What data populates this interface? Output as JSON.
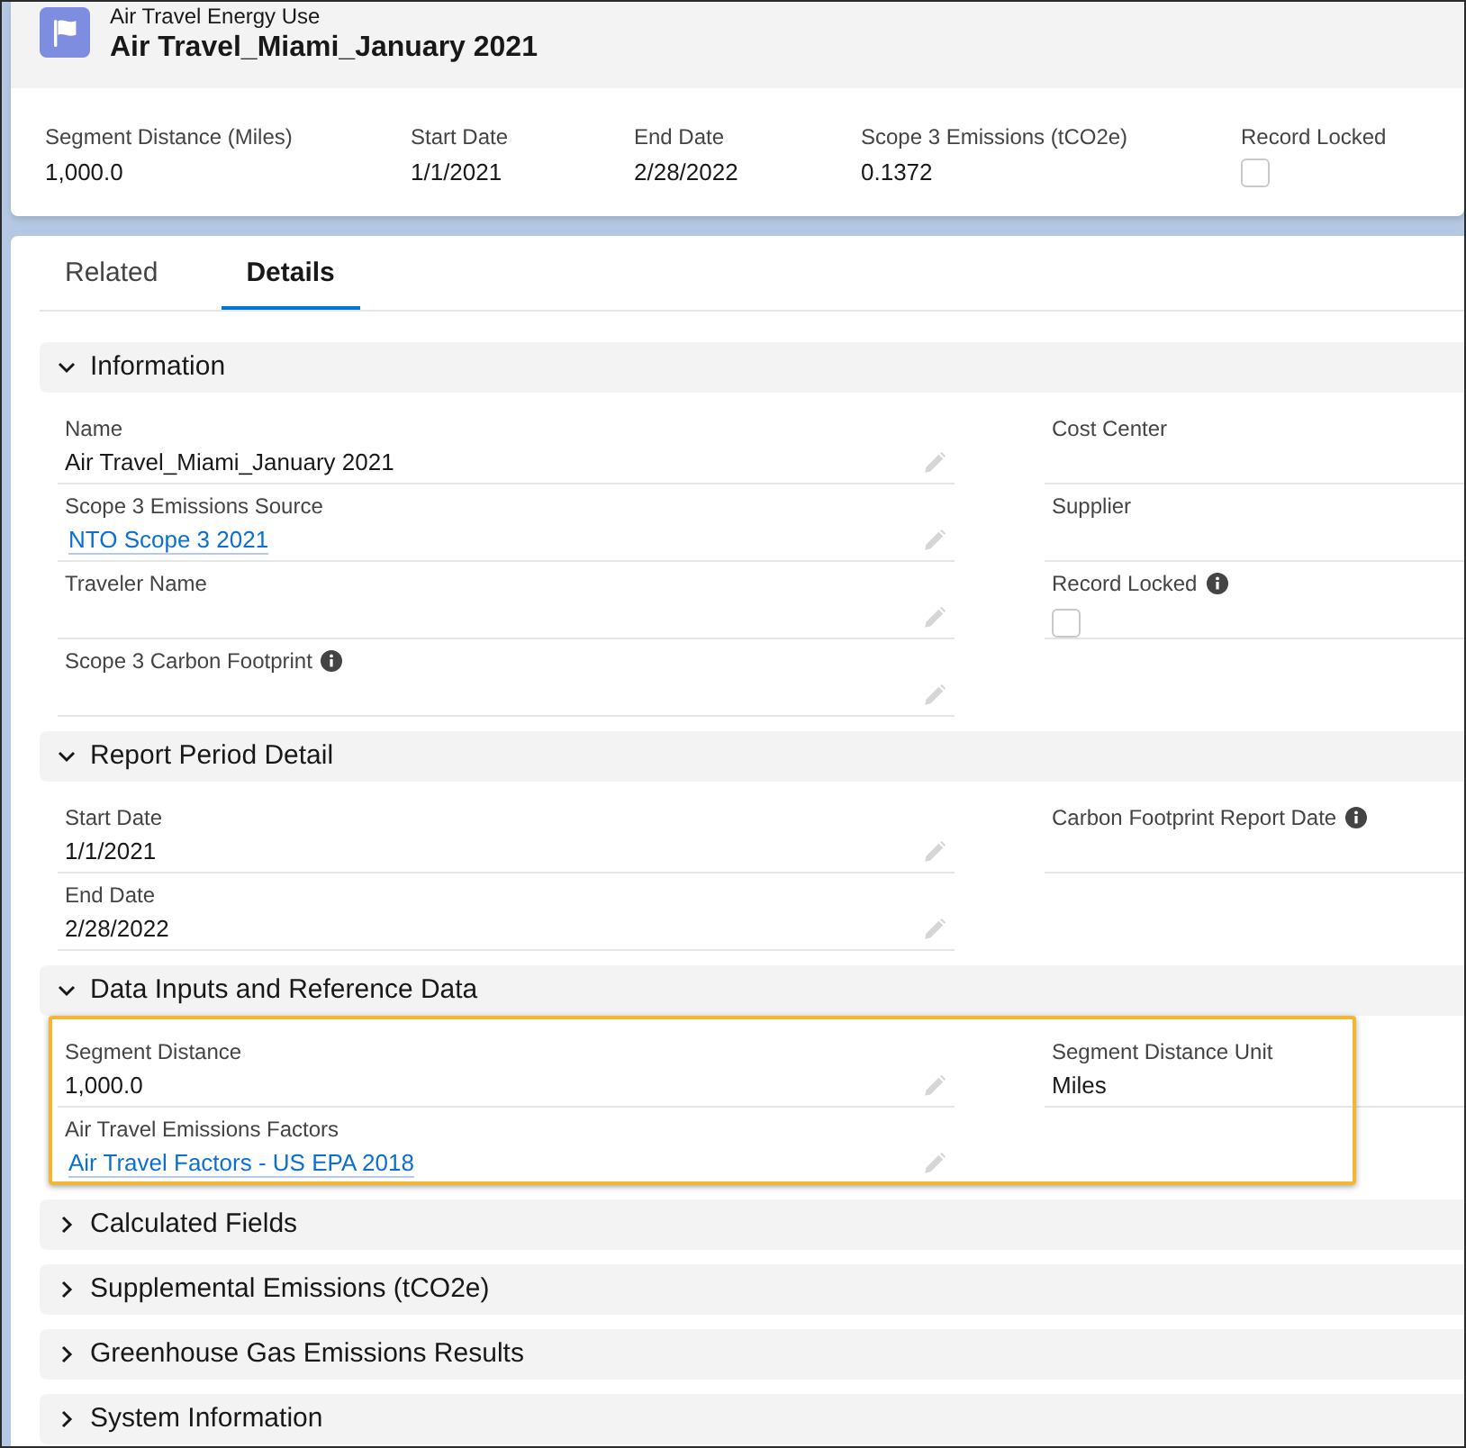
{
  "record": {
    "object_type": "Air Travel Energy Use",
    "title": "Air Travel_Miami_January 2021"
  },
  "highlights": [
    {
      "kind": "text",
      "label": "Segment Distance (Miles)",
      "value": "1,000.0"
    },
    {
      "kind": "text",
      "label": "Start Date",
      "value": "1/1/2021"
    },
    {
      "kind": "text",
      "label": "End Date",
      "value": "2/28/2022"
    },
    {
      "kind": "text",
      "label": "Scope 3 Emissions (tCO2e)",
      "value": "0.1372"
    },
    {
      "kind": "checkbox",
      "label": "Record Locked",
      "checked": false
    }
  ],
  "tabs": [
    {
      "label": "Related",
      "selected": false
    },
    {
      "label": "Details",
      "selected": true
    }
  ],
  "sections": [
    {
      "title": "Information",
      "expanded": true,
      "highlighted": false,
      "rows": [
        [
          {
            "kind": "text",
            "label": "Name",
            "value": "Air Travel_Miami_January 2021",
            "info": false,
            "editable": true
          },
          {
            "kind": "text",
            "label": "Cost Center",
            "info": false,
            "editable": false
          }
        ],
        [
          {
            "kind": "link",
            "label": "Scope 3 Emissions Source",
            "value": "NTO Scope 3 2021",
            "info": false,
            "editable": true
          },
          {
            "kind": "text",
            "label": "Supplier",
            "info": false,
            "editable": false
          }
        ],
        [
          {
            "kind": "text",
            "label": "Traveler Name",
            "info": false,
            "editable": true
          },
          {
            "kind": "checkbox",
            "label": "Record Locked",
            "info": true,
            "checked": false,
            "editable": false
          }
        ],
        [
          {
            "kind": "text",
            "label": "Scope 3 Carbon Footprint",
            "info": true,
            "editable": true
          }
        ]
      ]
    },
    {
      "title": "Report Period Detail",
      "expanded": true,
      "highlighted": false,
      "rows": [
        [
          {
            "kind": "text",
            "label": "Start Date",
            "value": "1/1/2021",
            "info": false,
            "editable": true
          },
          {
            "kind": "text",
            "label": "Carbon Footprint Report Date",
            "info": true,
            "editable": false
          }
        ],
        [
          {
            "kind": "text",
            "label": "End Date",
            "value": "2/28/2022",
            "info": false,
            "editable": true
          }
        ]
      ]
    },
    {
      "title": "Data Inputs and Reference Data",
      "expanded": true,
      "highlighted": true,
      "rows": [
        [
          {
            "kind": "text",
            "label": "Segment Distance",
            "value": "1,000.0",
            "info": false,
            "editable": true
          },
          {
            "kind": "text",
            "label": "Segment Distance Unit",
            "value": "Miles",
            "info": false,
            "editable": false
          }
        ],
        [
          {
            "kind": "link",
            "label": "Air Travel Emissions Factors",
            "value": "Air Travel Factors - US EPA 2018",
            "info": false,
            "editable": true
          }
        ]
      ]
    },
    {
      "title": "Calculated Fields",
      "expanded": false,
      "highlighted": false
    },
    {
      "title": "Supplemental Emissions (tCO2e)",
      "expanded": false,
      "highlighted": false
    },
    {
      "title": "Greenhouse Gas Emissions Results",
      "expanded": false,
      "highlighted": false
    },
    {
      "title": "System Information",
      "expanded": false,
      "highlighted": false
    }
  ]
}
